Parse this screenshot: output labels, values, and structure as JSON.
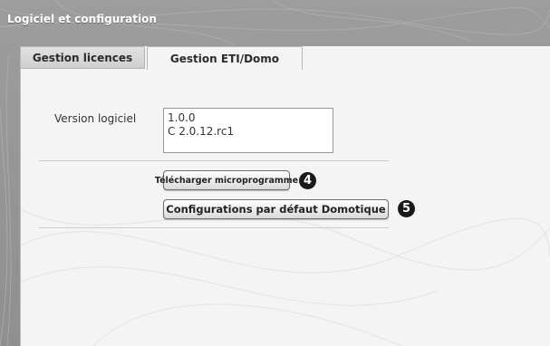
{
  "window": {
    "title": "Logiciel et configuration"
  },
  "tabs": [
    {
      "label": "Gestion licences",
      "active": false
    },
    {
      "label": "Gestion ETI/Domo",
      "active": true
    }
  ],
  "version": {
    "label": "Version logiciel",
    "lines": [
      "1.0.0",
      "C 2.0.12.rc1"
    ]
  },
  "actions": {
    "firmware_label": "Télécharger microprogramme",
    "defaults_label": "Configurations par défaut Domotique"
  },
  "callouts": [
    "4",
    "5"
  ],
  "colors": {
    "frame": "#9a9a9a",
    "panel": "#f4f4f4",
    "callout": "#1a1a1a"
  }
}
